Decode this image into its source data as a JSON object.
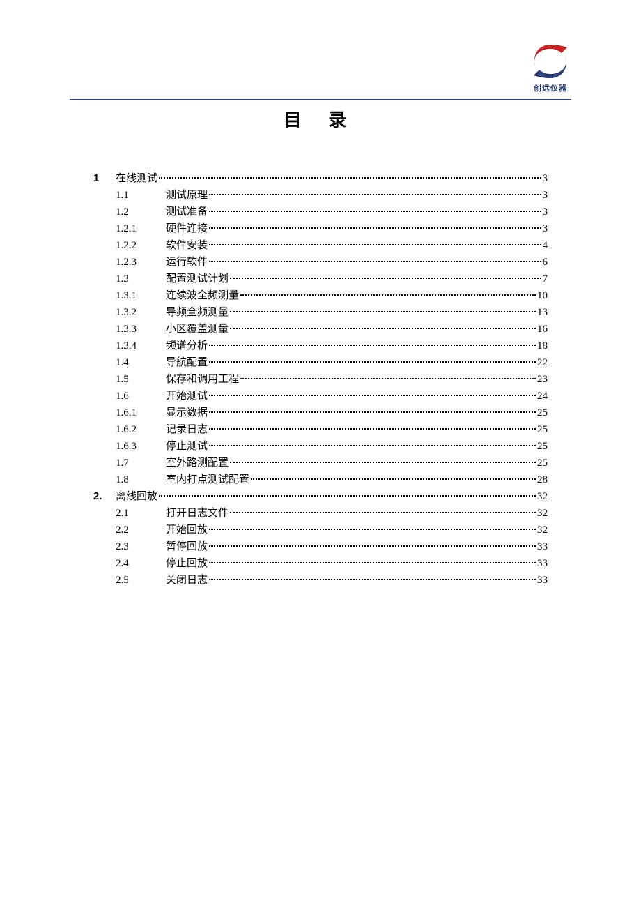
{
  "logo_caption": "创远仪器",
  "title": "目 录",
  "toc": [
    {
      "level": 0,
      "chapter": "1",
      "num": "",
      "title": "在线测试",
      "page": "3"
    },
    {
      "level": 1,
      "chapter": "",
      "num": "1.1",
      "title": "测试原理",
      "page": "3"
    },
    {
      "level": 1,
      "chapter": "",
      "num": "1.2",
      "title": "测试准备",
      "page": "3"
    },
    {
      "level": 2,
      "chapter": "",
      "num": "1.2.1",
      "title": "硬件连接",
      "page": "3"
    },
    {
      "level": 2,
      "chapter": "",
      "num": "1.2.2",
      "title": "软件安装",
      "page": "4"
    },
    {
      "level": 2,
      "chapter": "",
      "num": "1.2.3",
      "title": "运行软件",
      "page": "6"
    },
    {
      "level": 1,
      "chapter": "",
      "num": "1.3",
      "title": "配置测试计划",
      "page": "7"
    },
    {
      "level": 2,
      "chapter": "",
      "num": "1.3.1",
      "title": "连续波全频测量",
      "page": "10"
    },
    {
      "level": 2,
      "chapter": "",
      "num": "1.3.2",
      "title": "导频全频测量",
      "page": "13"
    },
    {
      "level": 2,
      "chapter": "",
      "num": "1.3.3",
      "title": "小区覆盖测量",
      "page": "16"
    },
    {
      "level": 2,
      "chapter": "",
      "num": "1.3.4",
      "title": "频谱分析",
      "page": "18"
    },
    {
      "level": 1,
      "chapter": "",
      "num": "1.4",
      "title": "导航配置",
      "page": "22"
    },
    {
      "level": 1,
      "chapter": "",
      "num": "1.5",
      "title": "保存和调用工程",
      "page": "23"
    },
    {
      "level": 1,
      "chapter": "",
      "num": "1.6",
      "title": "开始测试",
      "page": "24"
    },
    {
      "level": 2,
      "chapter": "",
      "num": "1.6.1",
      "title": "显示数据",
      "page": "25"
    },
    {
      "level": 2,
      "chapter": "",
      "num": "1.6.2",
      "title": "记录日志",
      "page": "25"
    },
    {
      "level": 2,
      "chapter": "",
      "num": "1.6.3",
      "title": "停止测试",
      "page": "25"
    },
    {
      "level": 1,
      "chapter": "",
      "num": "1.7",
      "title": "室外路测配置",
      "page": "25"
    },
    {
      "level": 1,
      "chapter": "",
      "num": "1.8",
      "title": "室内打点测试配置",
      "page": "28"
    },
    {
      "level": 0,
      "chapter": "2.",
      "num": "",
      "title": "离线回放",
      "page": "32"
    },
    {
      "level": 1,
      "chapter": "",
      "num": "2.1",
      "title": "打开日志文件",
      "page": "32"
    },
    {
      "level": 1,
      "chapter": "",
      "num": "2.2",
      "title": "开始回放",
      "page": "32"
    },
    {
      "level": 1,
      "chapter": "",
      "num": "2.3",
      "title": "暂停回放",
      "page": "33"
    },
    {
      "level": 1,
      "chapter": "",
      "num": "2.4",
      "title": "停止回放",
      "page": "33"
    },
    {
      "level": 1,
      "chapter": "",
      "num": "2.5",
      "title": "关闭日志",
      "page": "33"
    }
  ]
}
